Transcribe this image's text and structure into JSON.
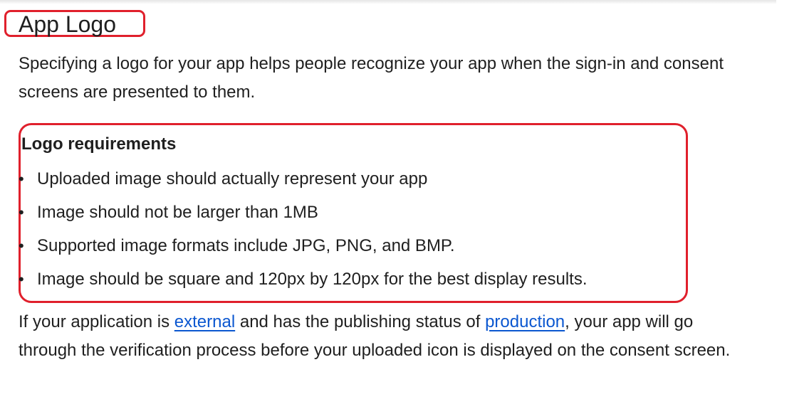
{
  "page": {
    "title": "App Logo",
    "intro": "Specifying a logo for your app helps people recognize your app when the sign-in and consent screens are presented to them."
  },
  "requirements": {
    "heading": "Logo requirements",
    "items": [
      "Uploaded image should actually represent your app",
      "Image should not be larger than 1MB",
      "Supported image formats include JPG, PNG, and BMP.",
      "Image should be square and 120px by 120px for the best display results."
    ]
  },
  "outro": {
    "part1": "If your application is ",
    "link1": "external",
    "part2": " and has the publishing status of ",
    "link2": "production",
    "part3": ", your app will go through the verification process before your uploaded icon is displayed on the consent screen."
  },
  "colors": {
    "annotation": "#e0202c",
    "link": "#0b57d0",
    "text": "#1f1f1f"
  }
}
